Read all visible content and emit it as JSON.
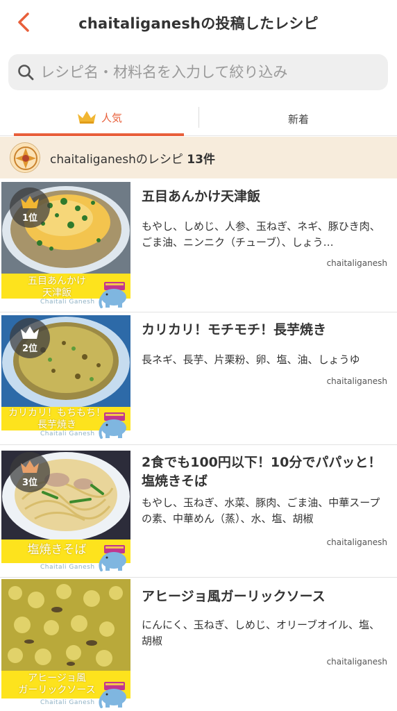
{
  "header": {
    "back_icon": "chevron-left-icon",
    "title": "chaitaliganeshの投稿したレシピ",
    "accent_color": "#e85f3a"
  },
  "search": {
    "icon": "search-icon",
    "placeholder": "レシピ名・材料名を入力して絞り込み"
  },
  "tabs": [
    {
      "label": "人気",
      "icon": "crown-icon",
      "active": true
    },
    {
      "label": "新着",
      "active": false
    }
  ],
  "banner": {
    "avatar_icon": "mandala-avatar",
    "text": "chaitaliganeshのレシピ",
    "count": "13件"
  },
  "recipes": [
    {
      "rank": "1位",
      "rank_color": "#f1b632",
      "title": "五目あんかけ天津飯",
      "ingredients": "もやし、しめじ、人参、玉ねぎ、ネギ、豚ひき肉、ごま油、ニンニク（チューブ）、しょう…",
      "author": "chaitaliganesh",
      "thumb_label": "五目あんかけ\n天津飯",
      "thumb_author": "Chaitali Ganesh"
    },
    {
      "rank": "2位",
      "rank_color": "#ffffff",
      "title": "カリカリ！モチモチ！長芋焼き",
      "ingredients": "長ネギ、長芋、片栗粉、卵、塩、油、しょうゆ",
      "author": "chaitaliganesh",
      "thumb_label": "カリカリ！もちもち！\n長芋焼き",
      "thumb_author": "Chaitali Ganesh"
    },
    {
      "rank": "3位",
      "rank_color": "#e8a06a",
      "title": "2食でも100円以下！10分でパパッと！塩焼きそば",
      "ingredients": "もやし、玉ねぎ、水菜、豚肉、ごま油、中華スープの素、中華めん（蒸）、水、塩、胡椒",
      "author": "chaitaliganesh",
      "thumb_label": "塩焼きそば",
      "thumb_author": "Chaitali Ganesh"
    },
    {
      "title": "アヒージョ風ガーリックソース",
      "ingredients": "にんにく、玉ねぎ、しめじ、オリーブオイル、塩、胡椒",
      "author": "chaitaliganesh",
      "thumb_label": "アヒージョ風\nガーリックソース",
      "thumb_author": "Chaitali Ganesh"
    }
  ]
}
